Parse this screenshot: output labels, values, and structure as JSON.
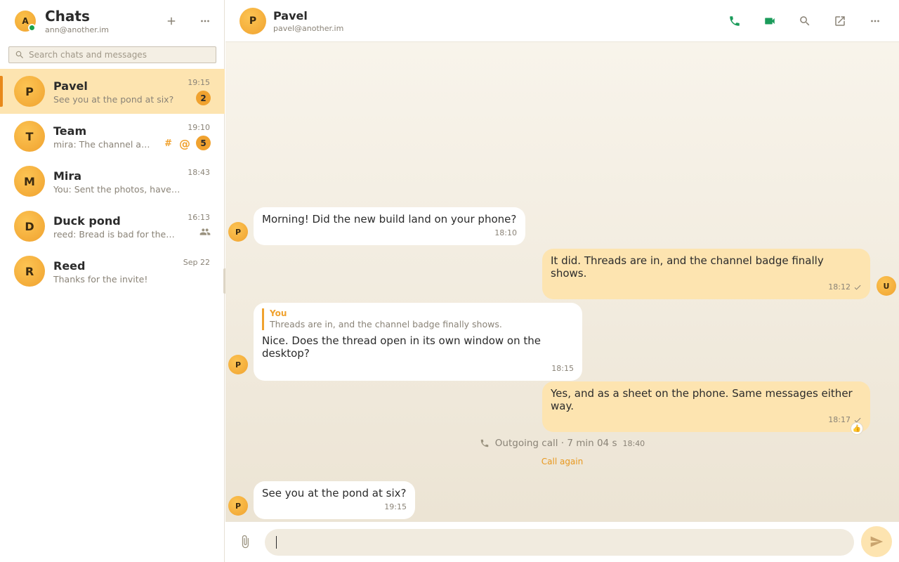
{
  "app": {
    "title": "Chats",
    "account": "ann@another.im",
    "avatar_letter": "A",
    "presence": "online"
  },
  "search": {
    "placeholder": "Search chats and messages"
  },
  "chats": [
    {
      "letter": "P",
      "name": "Pavel",
      "preview": "See you at the pond at six?",
      "time": "19:15",
      "badge": "2",
      "active": true
    },
    {
      "letter": "T",
      "name": "Team",
      "preview": "mira: The channel are...",
      "time": "19:10",
      "badge": "5",
      "channel": true,
      "mention": true
    },
    {
      "letter": "M",
      "name": "Mira",
      "preview": "You: Sent the photos, have ...",
      "time": "18:43"
    },
    {
      "letter": "D",
      "name": "Duck pond",
      "preview": "reed: Bread is bad for them...",
      "time": "16:13",
      "group": true
    },
    {
      "letter": "R",
      "name": "Reed",
      "preview": "Thanks for the invite!",
      "time": "Sep 22"
    }
  ],
  "conversation": {
    "name": "Pavel",
    "address": "pavel@another.im",
    "avatar_letter": "P",
    "messages": [
      {
        "dir": "in",
        "avatar": "P",
        "text": "Morning! Did the new build land on your phone?",
        "time": "18:10"
      },
      {
        "dir": "out",
        "avatar": "U",
        "text": "It did. Threads are in, and the channel badge finally shows.",
        "time": "18:12",
        "status": "sent"
      },
      {
        "dir": "in",
        "avatar": "P",
        "quote_author": "You",
        "quote_text": "Threads are in, and the channel badge finally shows.",
        "text": "Nice. Does the thread open in its own window on the desktop?",
        "time": "18:15"
      },
      {
        "dir": "out",
        "text": "Yes, and as a sheet on the phone. Same messages either way.",
        "time": "18:17",
        "status": "sent",
        "reaction": "👍"
      },
      {
        "dir": "in",
        "avatar": "P",
        "text": "See you at the pond at six?",
        "time": "19:15"
      }
    ],
    "call": {
      "label": "Outgoing call · 7 min 04 s",
      "time": "18:40",
      "action": "Call again"
    }
  },
  "composer": {
    "value": ""
  },
  "colors": {
    "accent": "#f0a22f",
    "active_bg": "#fde4b0",
    "call_icons": "#1a9b5a",
    "online": "#1aa34a"
  },
  "icons": [
    "plus-icon",
    "more-icon",
    "search-icon",
    "phone-icon",
    "video-icon",
    "open-window-icon",
    "paperclip-icon",
    "send-icon",
    "hash-icon",
    "at-icon",
    "group-icon",
    "check-icon"
  ]
}
